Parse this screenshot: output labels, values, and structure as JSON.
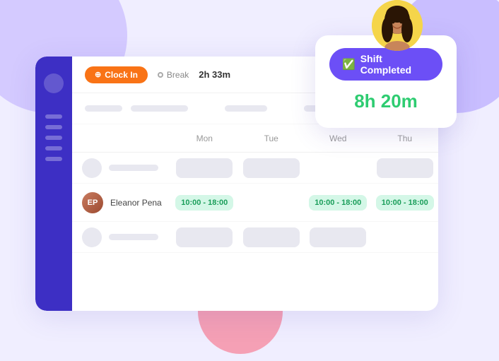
{
  "background": {
    "colors": {
      "main": "#f0eeff",
      "sidebar": "#3d2fc4",
      "card": "#ffffff",
      "circle1": "#d4caff",
      "circle2": "#f5a0b5",
      "circle3": "#c9beff"
    }
  },
  "toolbar": {
    "clock_in_label": "Clock In",
    "break_label": "Break",
    "duration": "2h 33m"
  },
  "shift_completed_card": {
    "badge_label": "Shift Completed",
    "time_label": "8h 20m"
  },
  "calendar": {
    "days": [
      "Mon",
      "Tue",
      "Wed",
      "Thu"
    ],
    "rows": [
      {
        "employee": "Eleanor Pena",
        "shifts": [
          "10:00 - 18:00",
          "",
          "10:00 - 18:00",
          "10:00 - 18:00"
        ]
      }
    ]
  }
}
